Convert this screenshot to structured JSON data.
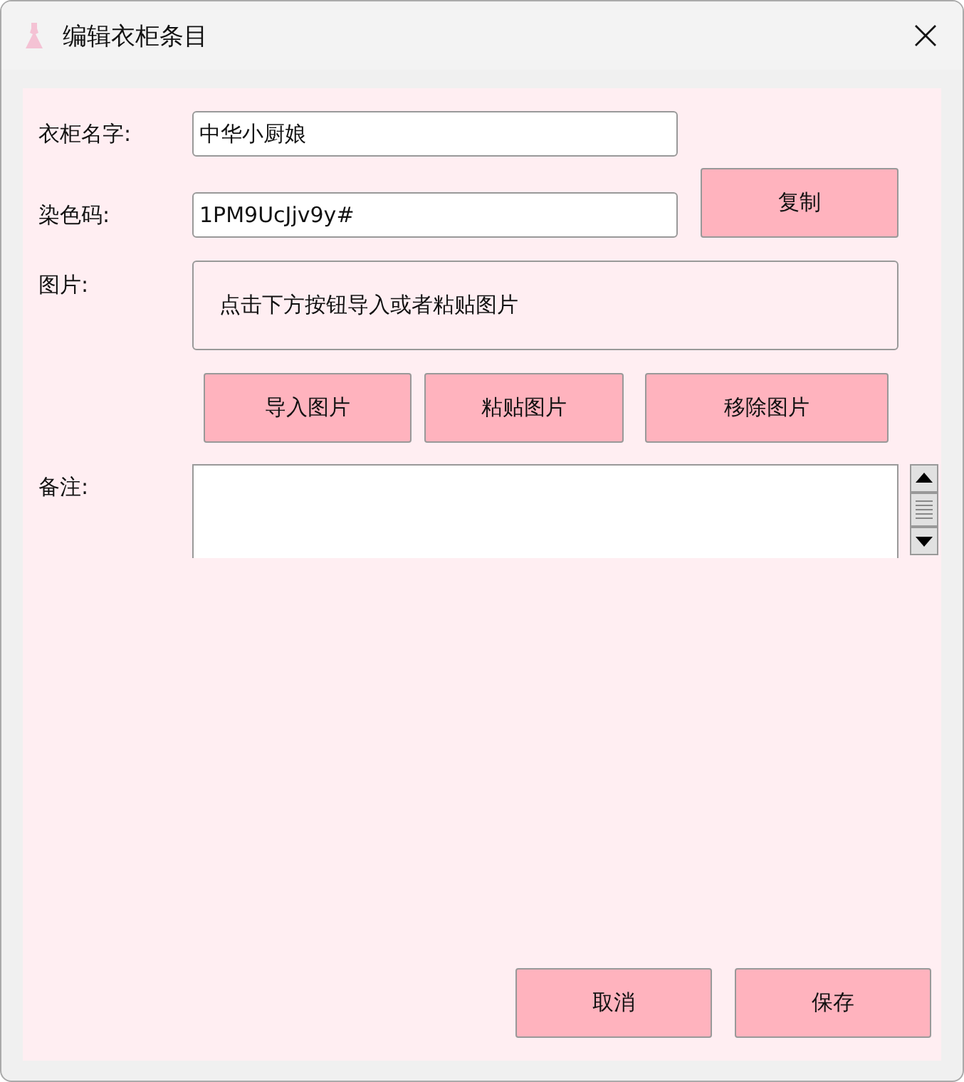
{
  "window": {
    "title": "编辑衣柜条目"
  },
  "form": {
    "name_label": "衣柜名字:",
    "name_value": "中华小厨娘",
    "code_label": "染色码:",
    "code_value": "1PM9UcJjv9y#",
    "copy_button": "复制",
    "picture_label": "图片:",
    "picture_hint": "点击下方按钮导入或者粘贴图片",
    "picture_buttons": [
      "导入图片",
      "粘贴图片",
      "移除图片"
    ],
    "notes_label": "备注:"
  },
  "buttons": [
    "取消",
    "保存"
  ]
}
